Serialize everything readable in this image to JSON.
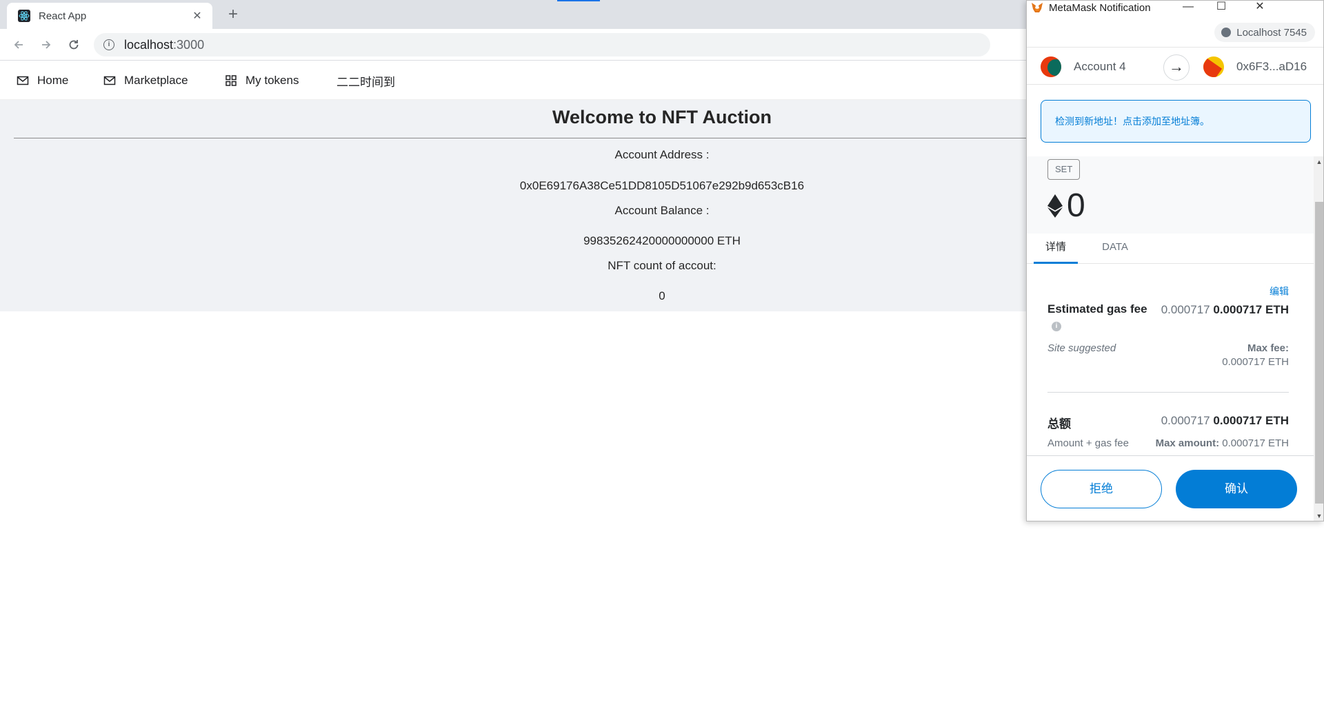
{
  "browser": {
    "tab_title": "React App",
    "tab_close": "✕",
    "new_tab": "+",
    "url_host": "localhost",
    "url_port": ":3000"
  },
  "menu": {
    "items": [
      {
        "label": "Home",
        "icon": "mail-icon"
      },
      {
        "label": "Marketplace",
        "icon": "mail-icon"
      },
      {
        "label": "My tokens",
        "icon": "appstore-icon"
      },
      {
        "label": "二二时间到",
        "icon": ""
      }
    ]
  },
  "page": {
    "title": "Welcome to NFT Auction",
    "address_label": "Account Address :",
    "address_value": "0x0E69176A38Ce51DD8105D51067e292b9d653cB16",
    "balance_label": "Account Balance :",
    "balance_value": "99835262420000000000 ETH",
    "nft_label": "NFT count of accout:",
    "nft_value": "0"
  },
  "metamask": {
    "window_title": "MetaMask Notification",
    "origin": "Localhost 7545",
    "from_account": "Account 4",
    "to_account": "0x6F3...aD16",
    "alert_text": "检测到新地址！点击添加至地址簿。",
    "method_badge": "SET",
    "amount": "0",
    "tabs": [
      "详情",
      "DATA"
    ],
    "edit_label": "编辑",
    "gas_label": "Estimated gas fee",
    "gas_light": "0.000717",
    "gas_bold": "0.000717 ETH",
    "site_suggested": "Site suggested",
    "max_fee_label": "Max fee:",
    "max_fee_value": "0.000717 ETH",
    "total_label": "总额",
    "total_light": "0.000717",
    "total_bold": "0.000717 ETH",
    "amount_gas_label": "Amount + gas fee",
    "max_amount_label": "Max amount:",
    "max_amount_value": "0.000717 ETH",
    "reject_label": "拒绝",
    "confirm_label": "确认"
  },
  "colors": {
    "metamask_blue": "#037dd6",
    "content_bg": "#f0f2f5"
  }
}
